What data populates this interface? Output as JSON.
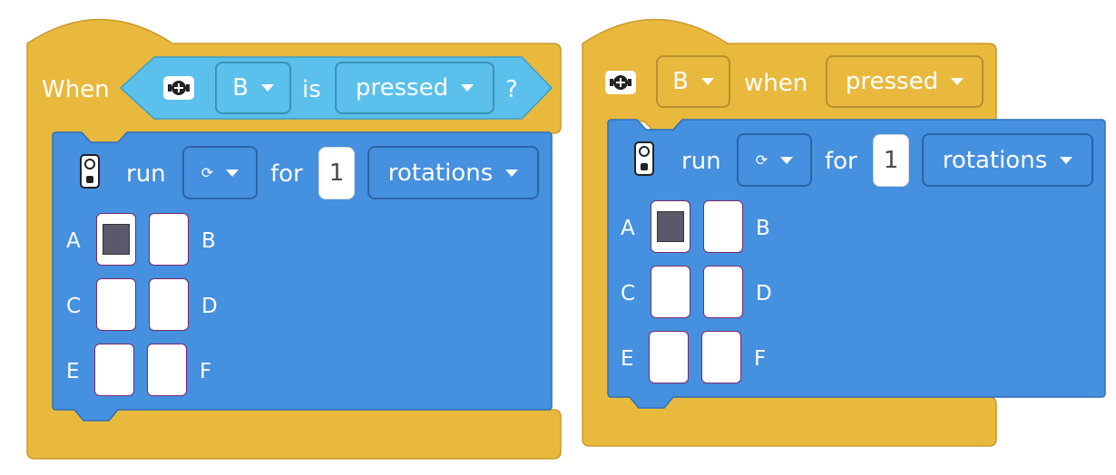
{
  "left_block": {
    "hat_label": "When",
    "condition": {
      "button_value": "B",
      "is_label": "is",
      "state_value": "pressed",
      "question": "?"
    },
    "icons": {
      "hub": "hub-button-icon",
      "motor": "remote-motor-icon"
    },
    "run": {
      "run_label": "run",
      "direction_glyph": "⟳",
      "for_label": "for",
      "amount": "1",
      "unit_value": "rotations"
    },
    "ports": [
      {
        "letter": "A",
        "selected": true
      },
      {
        "letter": "B",
        "selected": false
      },
      {
        "letter": "C",
        "selected": false
      },
      {
        "letter": "D",
        "selected": false
      },
      {
        "letter": "E",
        "selected": false
      },
      {
        "letter": "F",
        "selected": false
      }
    ]
  },
  "right_block": {
    "header": {
      "button_value": "B",
      "when_label": "when",
      "state_value": "pressed"
    },
    "icons": {
      "hub": "hub-button-icon",
      "motor": "remote-motor-icon"
    },
    "run": {
      "run_label": "run",
      "direction_glyph": "⟳",
      "for_label": "for",
      "amount": "1",
      "unit_value": "rotations"
    },
    "ports": [
      {
        "letter": "A",
        "selected": true
      },
      {
        "letter": "B",
        "selected": false
      },
      {
        "letter": "C",
        "selected": false
      },
      {
        "letter": "D",
        "selected": false
      },
      {
        "letter": "E",
        "selected": false
      },
      {
        "letter": "F",
        "selected": false
      }
    ]
  },
  "colors": {
    "event_yellow": "#E8B93D",
    "motor_blue": "#4590DF",
    "sensor_light_blue": "#5BC0EB",
    "selected_port": "#59596B"
  }
}
